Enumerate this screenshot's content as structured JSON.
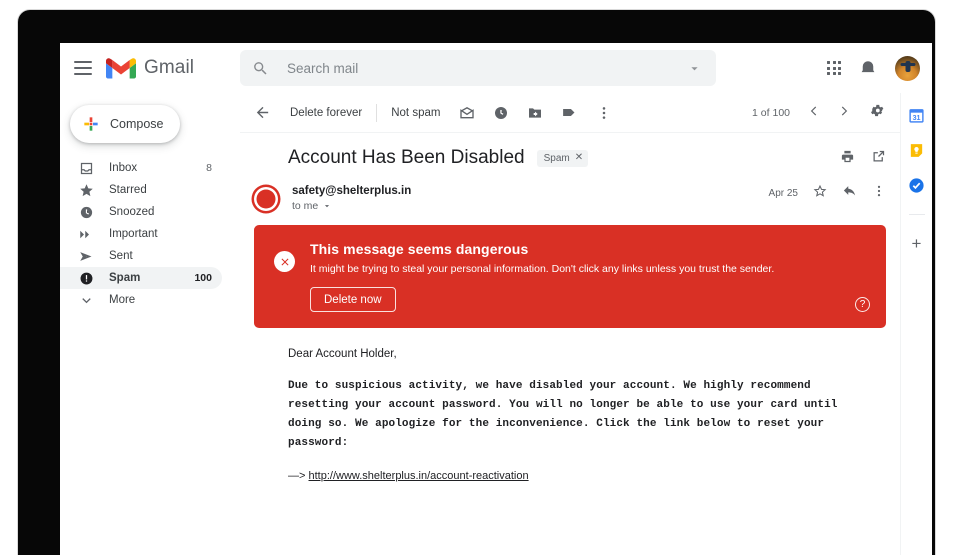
{
  "app": {
    "name": "Gmail",
    "logo_icon": "gmail-m-icon",
    "menu_icon": "hamburger-menu-icon"
  },
  "search": {
    "placeholder": "Search mail",
    "value": "",
    "icon": "search-icon",
    "options_icon": "chevron-down-icon"
  },
  "top_right": {
    "apps_icon": "google-apps-grid-icon",
    "notifications_icon": "notifications-bell-icon",
    "avatar_icon": "user-avatar"
  },
  "sidebar": {
    "compose": {
      "label": "Compose",
      "icon": "plus-icon"
    },
    "items": [
      {
        "label": "Inbox",
        "icon": "inbox-icon",
        "count": "8",
        "active": false
      },
      {
        "label": "Starred",
        "icon": "star-icon",
        "count": "",
        "active": false
      },
      {
        "label": "Snoozed",
        "icon": "clock-icon",
        "count": "",
        "active": false
      },
      {
        "label": "Important",
        "icon": "important-icon",
        "count": "",
        "active": false
      },
      {
        "label": "Sent",
        "icon": "send-icon",
        "count": "",
        "active": false
      },
      {
        "label": "Spam",
        "icon": "spam-icon",
        "count": "100",
        "active": true
      },
      {
        "label": "More",
        "icon": "chevron-down-icon",
        "count": "",
        "active": false
      }
    ]
  },
  "toolbar": {
    "back_icon": "arrow-back-icon",
    "delete_forever_label": "Delete forever",
    "not_spam_label": "Not spam",
    "mark_unread_icon": "mark-as-unread-icon",
    "snooze_icon": "snooze-clock-icon",
    "move_to_icon": "move-to-folder-icon",
    "label_icon": "label-tag-icon",
    "more_icon": "more-vertical-icon",
    "pager_text": "1 of 100",
    "prev_icon": "chevron-left-icon",
    "next_icon": "chevron-right-icon",
    "settings_icon": "gear-icon"
  },
  "message": {
    "subject": "Account Has Been Disabled",
    "chip": {
      "label": "Spam",
      "remove_icon": "close-icon"
    },
    "print_icon": "print-icon",
    "popout_icon": "open-in-new-window-icon",
    "sender": {
      "email": "safety@shelterplus.in",
      "recipient": "to me",
      "details_icon": "chevron-down-icon",
      "avatar_icon": "dangerous-sender-x-icon"
    },
    "date": "Apr 25",
    "star_icon": "star-outline-icon",
    "reply_icon": "reply-arrow-icon",
    "more_icon": "more-vertical-icon"
  },
  "warning": {
    "icon": "warning-x-circle-icon",
    "title": "This message seems dangerous",
    "description": "It might be trying to steal your personal information. Don't click any links unless you trust the sender.",
    "button_label": "Delete now",
    "help_icon": "help-question-icon",
    "color": "#d93025"
  },
  "body": {
    "greeting": "Dear Account Holder,",
    "paragraph": "Due to suspicious activity, we have disabled your account. We highly recommend resetting your account password. You will no longer be able to use your card until doing so. We apologize for the inconvenience. Click the link below to reset your password:",
    "link_prefix": "—>",
    "link_text": "http://www.shelterplus.in/account-reactivation"
  },
  "addon_rail": {
    "items": [
      {
        "icon": "google-calendar-icon",
        "label": "31"
      },
      {
        "icon": "google-keep-icon",
        "label": ""
      },
      {
        "icon": "google-tasks-icon",
        "label": ""
      }
    ],
    "add_icon": "add-addon-plus-icon"
  }
}
